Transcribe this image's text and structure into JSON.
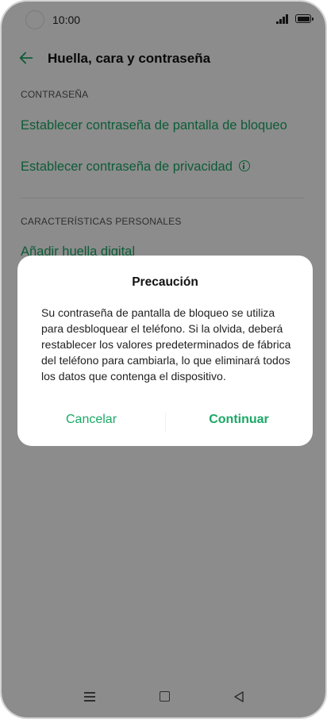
{
  "status_bar": {
    "time": "10:00"
  },
  "header": {
    "title": "Huella, cara y contraseña",
    "back_icon": "arrow-left-icon"
  },
  "sections": {
    "password_label": "CONTRASEÑA",
    "lock_screen_link": "Establecer contraseña de pantalla de bloqueo",
    "privacy_link": "Establecer contraseña de privacidad",
    "personal_label": "CARACTERÍSTICAS PERSONALES",
    "fingerprint_link": "Añadir huella digital"
  },
  "dialog": {
    "title": "Precaución",
    "body": "Su contraseña de pantalla de bloqueo se utiliza para desbloquear el teléfono. Si la olvida, deberá restablecer los valores predeterminados de fábrica del teléfono para cambiarla, lo que eliminará todos los datos que contenga el dispositivo.",
    "cancel_label": "Cancelar",
    "continue_label": "Continuar"
  },
  "colors": {
    "accent": "#1aa866",
    "scrim": "rgba(0,0,0,0.45)"
  }
}
